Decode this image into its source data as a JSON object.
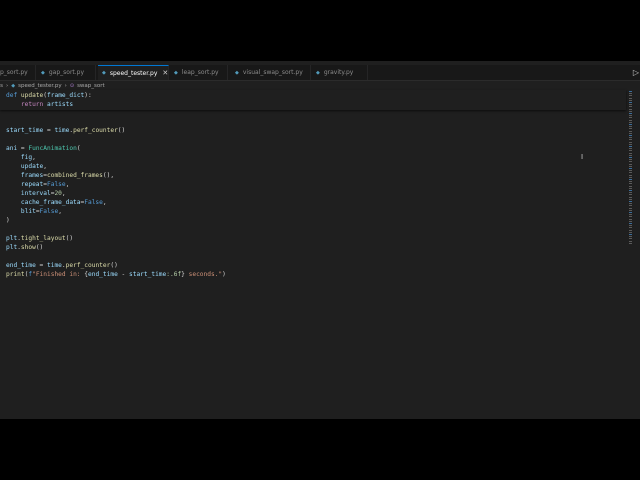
{
  "tabs": [
    {
      "label": "p_sort.py",
      "active": false
    },
    {
      "label": "gap_sort.py",
      "active": false
    },
    {
      "label": "speed_tester.py",
      "active": true
    },
    {
      "label": "leap_sort.py",
      "active": false
    },
    {
      "label": "visual_swap_sort.py",
      "active": false
    },
    {
      "label": "gravity.py",
      "active": false
    }
  ],
  "breadcrumb": {
    "folder": "ts",
    "file": "speed_tester.py",
    "symbol": "swap_sort"
  },
  "sticky": [
    {
      "parts": [
        [
          "kw",
          "def"
        ],
        [
          "op",
          " "
        ],
        [
          "fn",
          "update"
        ],
        [
          "op",
          "("
        ],
        [
          "var",
          "frame_dict"
        ],
        [
          "op",
          "):"
        ]
      ]
    },
    {
      "parts": [
        [
          "op",
          "    "
        ],
        [
          "kw2",
          "return"
        ],
        [
          "op",
          " "
        ],
        [
          "var",
          "artists"
        ]
      ]
    }
  ],
  "code": [
    [
      [
        "var",
        "start_time"
      ],
      [
        "op",
        " = "
      ],
      [
        "var",
        "time"
      ],
      [
        "op",
        "."
      ],
      [
        "fn",
        "perf_counter"
      ],
      [
        "op",
        "()"
      ]
    ],
    [],
    [
      [
        "var",
        "ani"
      ],
      [
        "op",
        " = "
      ],
      [
        "cls",
        "FuncAnimation"
      ],
      [
        "op",
        "("
      ]
    ],
    [
      [
        "op",
        "    "
      ],
      [
        "var",
        "fig"
      ],
      [
        "op",
        ","
      ]
    ],
    [
      [
        "op",
        "    "
      ],
      [
        "var",
        "update"
      ],
      [
        "op",
        ","
      ]
    ],
    [
      [
        "op",
        "    "
      ],
      [
        "var",
        "frames"
      ],
      [
        "op",
        "="
      ],
      [
        "fn",
        "combined_frames"
      ],
      [
        "op",
        "(),"
      ]
    ],
    [
      [
        "op",
        "    "
      ],
      [
        "var",
        "repeat"
      ],
      [
        "op",
        "="
      ],
      [
        "kw",
        "False"
      ],
      [
        "op",
        ","
      ]
    ],
    [
      [
        "op",
        "    "
      ],
      [
        "var",
        "interval"
      ],
      [
        "op",
        "="
      ],
      [
        "num",
        "20"
      ],
      [
        "op",
        ","
      ]
    ],
    [
      [
        "op",
        "    "
      ],
      [
        "var",
        "cache_frame_data"
      ],
      [
        "op",
        "="
      ],
      [
        "kw",
        "False"
      ],
      [
        "op",
        ","
      ]
    ],
    [
      [
        "op",
        "    "
      ],
      [
        "var",
        "blit"
      ],
      [
        "op",
        "="
      ],
      [
        "kw",
        "False"
      ],
      [
        "op",
        ","
      ]
    ],
    [
      [
        "op",
        ")"
      ]
    ],
    [],
    [
      [
        "var",
        "plt"
      ],
      [
        "op",
        "."
      ],
      [
        "fn",
        "tight_layout"
      ],
      [
        "op",
        "()"
      ]
    ],
    [
      [
        "var",
        "plt"
      ],
      [
        "op",
        "."
      ],
      [
        "fn",
        "show"
      ],
      [
        "op",
        "()"
      ]
    ],
    [],
    [
      [
        "var",
        "end_time"
      ],
      [
        "op",
        " = "
      ],
      [
        "var",
        "time"
      ],
      [
        "op",
        "."
      ],
      [
        "fn",
        "perf_counter"
      ],
      [
        "op",
        "()"
      ]
    ],
    [
      [
        "fn",
        "print"
      ],
      [
        "op",
        "("
      ],
      [
        "kw",
        "f"
      ],
      [
        "str",
        "\"Finished in: "
      ],
      [
        "op",
        "{"
      ],
      [
        "var",
        "end_time"
      ],
      [
        "op",
        " - "
      ],
      [
        "var",
        "start_time"
      ],
      [
        "num",
        ":.6f"
      ],
      [
        "op",
        "}"
      ],
      [
        "str",
        " seconds.\""
      ],
      [
        "op",
        ")"
      ]
    ]
  ],
  "colors": {
    "editor_bg": "#1f1f1f",
    "tab_bar_bg": "#181818",
    "active_tab_border": "#0078d4",
    "keyword": "#569cd6",
    "function": "#dcdcaa",
    "variable": "#9cdcfe",
    "string": "#ce9178",
    "number": "#b5cea8",
    "class": "#4ec9b0"
  },
  "icons": {
    "python_file": "python-file-icon",
    "close": "close-icon",
    "run": "run-icon",
    "symbol": "function-symbol-icon"
  }
}
